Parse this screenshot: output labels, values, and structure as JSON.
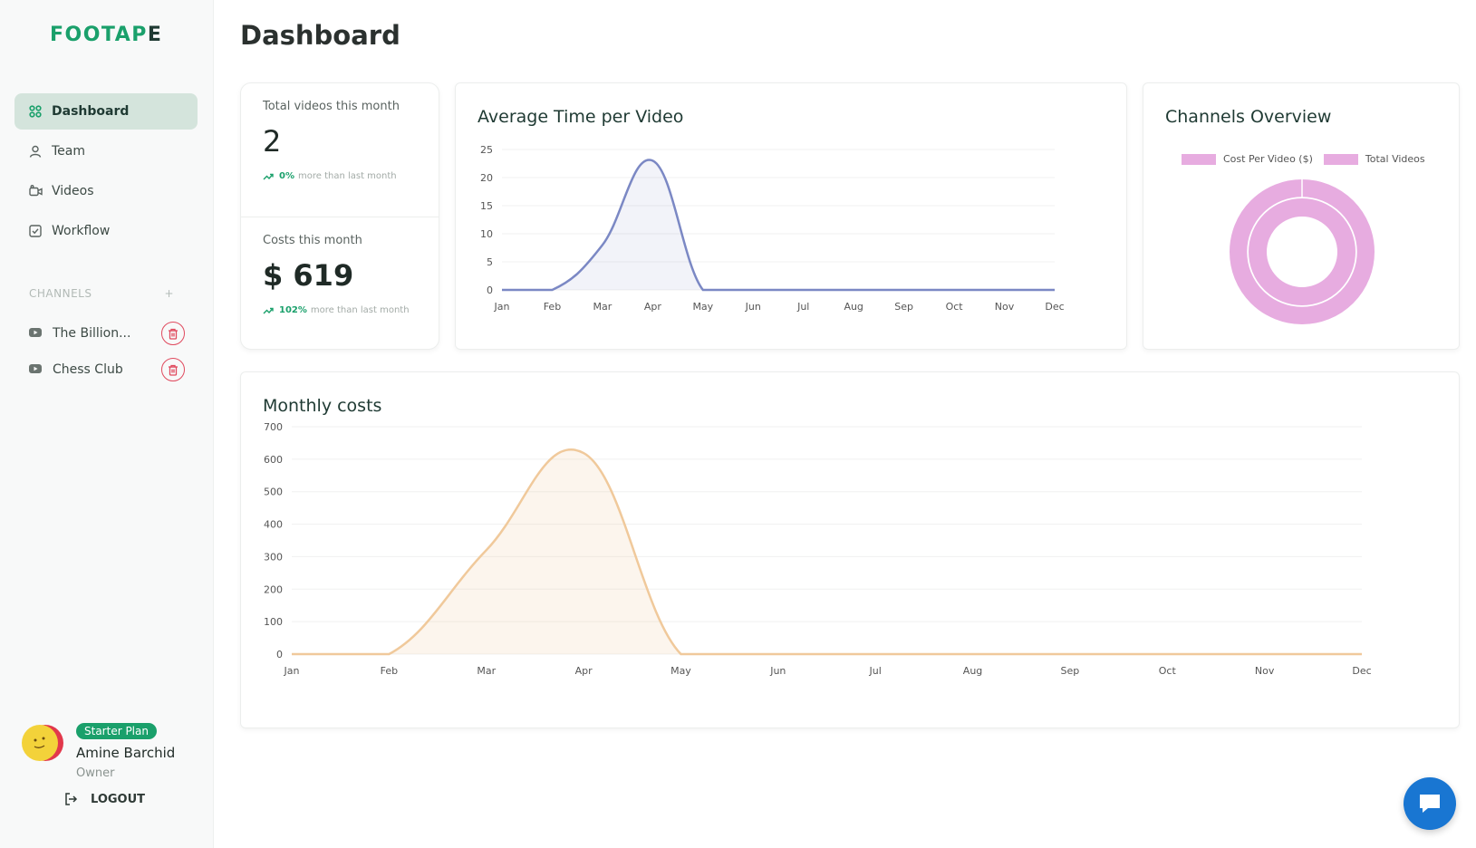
{
  "app": {
    "logo_left": "FOOTAP",
    "logo_right": "E"
  },
  "sidebar": {
    "nav": [
      {
        "label": "Dashboard",
        "icon": "grid-icon",
        "active": true
      },
      {
        "label": "Team",
        "icon": "user-icon",
        "active": false
      },
      {
        "label": "Videos",
        "icon": "video-icon",
        "active": false
      },
      {
        "label": "Workflow",
        "icon": "checkbox-icon",
        "active": false
      }
    ],
    "channels_title": "CHANNELS",
    "channels_add": "+",
    "channels": [
      {
        "name": "The Billion..."
      },
      {
        "name": "Chess Club"
      }
    ],
    "profile": {
      "plan": "Starter Plan",
      "name": "Amine Barchid",
      "role": "Owner"
    },
    "logout": "LOGOUT"
  },
  "main": {
    "title": "Dashboard",
    "stats": {
      "videos_label": "Total videos this month",
      "videos_value": "2",
      "videos_pct": "0%",
      "videos_trend": "more than last month",
      "costs_label": "Costs this month",
      "costs_value": "$ 619",
      "costs_pct": "102%",
      "costs_trend": "more than last month"
    },
    "avg_title": "Average Time per Video",
    "channels_title": "Channels Overview",
    "channels_legend": [
      "Cost Per Video ($)",
      "Total Videos"
    ],
    "costs_title": "Monthly costs"
  },
  "colors": {
    "accent": "#1aa06b",
    "avg_line": "#7b88c4",
    "cost_line": "#f0c99b",
    "donut": "#e7ace0",
    "danger": "#e04a5e",
    "chat": "#1976d2"
  },
  "chart_data": [
    {
      "type": "area",
      "title": "Average Time per Video",
      "categories": [
        "Jan",
        "Feb",
        "Mar",
        "Apr",
        "May",
        "Jun",
        "Jul",
        "Aug",
        "Sep",
        "Oct",
        "Nov",
        "Dec"
      ],
      "values": [
        0,
        0,
        8,
        23,
        0,
        0,
        0,
        0,
        0,
        0,
        0,
        0
      ],
      "ylim": [
        0,
        25
      ],
      "yticks": [
        0,
        5,
        10,
        15,
        20,
        25
      ]
    },
    {
      "type": "pie",
      "title": "Channels Overview",
      "series": [
        {
          "name": "Cost Per Video ($)",
          "values": [
            1
          ]
        },
        {
          "name": "Total Videos",
          "values": [
            1
          ]
        }
      ],
      "legend": "top"
    },
    {
      "type": "area",
      "title": "Monthly costs",
      "categories": [
        "Jan",
        "Feb",
        "Mar",
        "Apr",
        "May",
        "Jun",
        "Jul",
        "Aug",
        "Sep",
        "Oct",
        "Nov",
        "Dec"
      ],
      "values": [
        0,
        0,
        320,
        619,
        0,
        0,
        0,
        0,
        0,
        0,
        0,
        0
      ],
      "ylim": [
        0,
        700
      ],
      "yticks": [
        0,
        100,
        200,
        300,
        400,
        500,
        600,
        700
      ]
    }
  ]
}
